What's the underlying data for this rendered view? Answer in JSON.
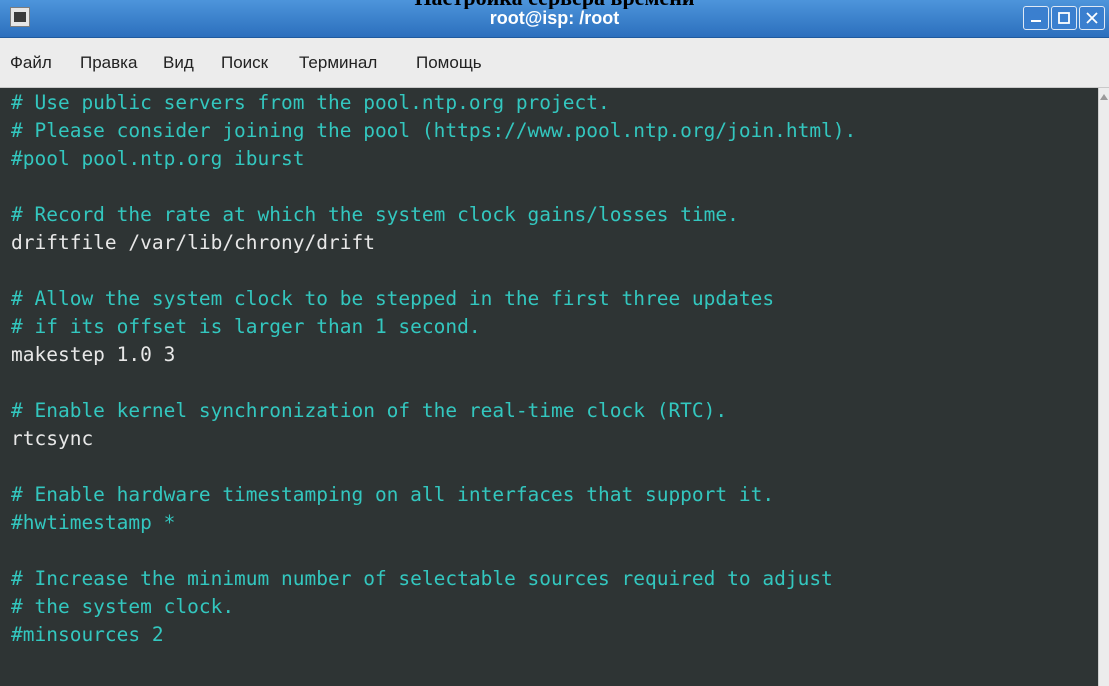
{
  "window": {
    "title": "root@isp: /root",
    "above_fragment": "Настройка сервера времени"
  },
  "menu": [
    "Файл",
    "Правка",
    "Вид",
    "Поиск",
    "Терминал",
    "Помощь"
  ],
  "terminal": {
    "lines": [
      {
        "text": "# Use public servers from the pool.ntp.org project.",
        "kind": "comment"
      },
      {
        "text": "# Please consider joining the pool (https://www.pool.ntp.org/join.html).",
        "kind": "comment"
      },
      {
        "text": "#pool pool.ntp.org iburst",
        "kind": "comment"
      },
      {
        "text": "",
        "kind": "blank"
      },
      {
        "text": "# Record the rate at which the system clock gains/losses time.",
        "kind": "comment"
      },
      {
        "text": "driftfile /var/lib/chrony/drift",
        "kind": "directive"
      },
      {
        "text": "",
        "kind": "blank"
      },
      {
        "text": "# Allow the system clock to be stepped in the first three updates",
        "kind": "comment"
      },
      {
        "text": "# if its offset is larger than 1 second.",
        "kind": "comment"
      },
      {
        "text": "makestep 1.0 3",
        "kind": "directive"
      },
      {
        "text": "",
        "kind": "blank"
      },
      {
        "text": "# Enable kernel synchronization of the real-time clock (RTC).",
        "kind": "comment"
      },
      {
        "text": "rtcsync",
        "kind": "directive"
      },
      {
        "text": "",
        "kind": "blank"
      },
      {
        "text": "# Enable hardware timestamping on all interfaces that support it.",
        "kind": "comment"
      },
      {
        "text": "#hwtimestamp *",
        "kind": "comment"
      },
      {
        "text": "",
        "kind": "blank"
      },
      {
        "text": "# Increase the minimum number of selectable sources required to adjust",
        "kind": "comment"
      },
      {
        "text": "# the system clock.",
        "kind": "comment"
      },
      {
        "text": "#minsources 2",
        "kind": "comment"
      }
    ]
  },
  "colors": {
    "comment": "#33c7bf",
    "directive": "#e8e8e8",
    "background": "#2e3434",
    "titlebar": "#2c6fbd"
  },
  "icons": {
    "app": "terminal-icon",
    "minimize": "minimize-icon",
    "maximize": "maximize-icon",
    "close": "close-icon"
  }
}
